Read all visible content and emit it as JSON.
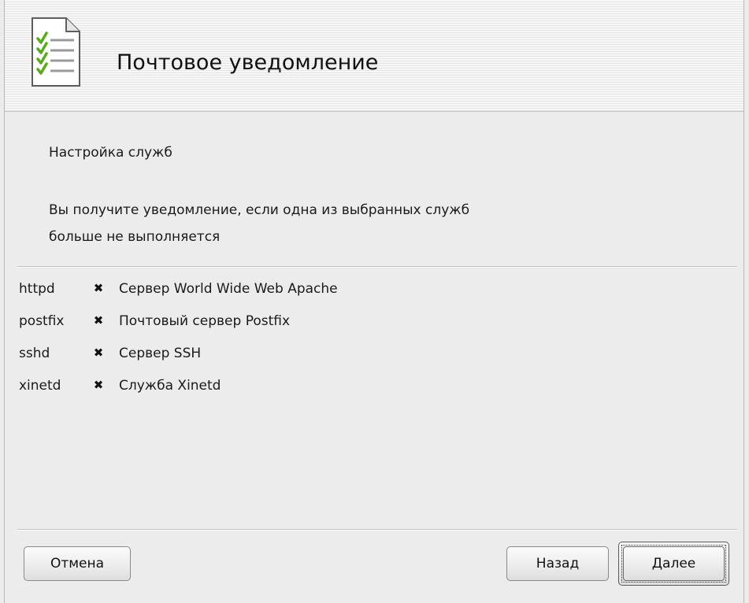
{
  "header": {
    "title": "Почтовое уведомление",
    "icon": "checklist-document-icon"
  },
  "section_title": "Настройка служб",
  "description": {
    "line1": "Вы получите уведомление, если одна из выбранных служб",
    "line2": "больше не выполняется"
  },
  "services": [
    {
      "name": "httpd",
      "checked": true,
      "check_glyph": "✖",
      "label": "Сервер World Wide Web Apache"
    },
    {
      "name": "postfix",
      "checked": true,
      "check_glyph": "✖",
      "label": "Почтовый сервер Postfix"
    },
    {
      "name": "sshd",
      "checked": true,
      "check_glyph": "✖",
      "label": "Сервер SSH"
    },
    {
      "name": "xinetd",
      "checked": true,
      "check_glyph": "✖",
      "label": "Служба Xinetd"
    }
  ],
  "buttons": {
    "cancel": "Отмена",
    "back": "Назад",
    "next": "Далее"
  },
  "colors": {
    "background": "#ececec",
    "check_green": "#5caa1e"
  }
}
